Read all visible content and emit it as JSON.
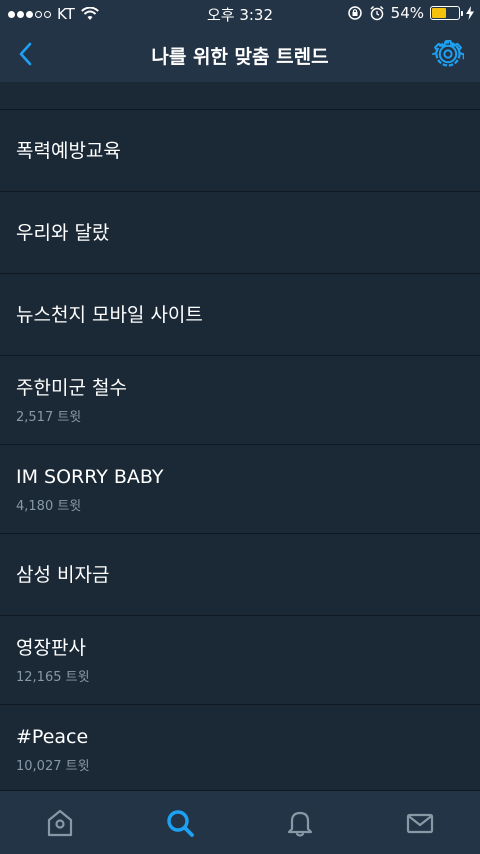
{
  "status_bar": {
    "carrier": "KT",
    "time": "오후 3:32",
    "battery_percent": "54%",
    "battery_level": 0.54,
    "signal_bars_filled": 3,
    "signal_bars_total": 5
  },
  "nav": {
    "title": "나를 위한 맞춤 트렌드"
  },
  "trends": [
    {
      "name": "폭력예방교육",
      "count": ""
    },
    {
      "name": "우리와 달랐",
      "count": ""
    },
    {
      "name": "뉴스천지 모바일 사이트",
      "count": ""
    },
    {
      "name": "주한미군 철수",
      "count": "2,517 트윗"
    },
    {
      "name": "IM SORRY BABY",
      "count": "4,180 트윗"
    },
    {
      "name": "삼성 비자금",
      "count": ""
    },
    {
      "name": "영장판사",
      "count": "12,165 트윗"
    },
    {
      "name": "#Peace",
      "count": "10,027 트윗"
    }
  ],
  "tab_bar": {
    "active_tab": "search",
    "tabs": [
      "home",
      "search",
      "notifications",
      "messages"
    ]
  },
  "colors": {
    "background": "#1b2836",
    "bar": "#243447",
    "accent": "#1da1f2",
    "secondary_text": "#8899a6",
    "battery": "#f4c20d"
  }
}
